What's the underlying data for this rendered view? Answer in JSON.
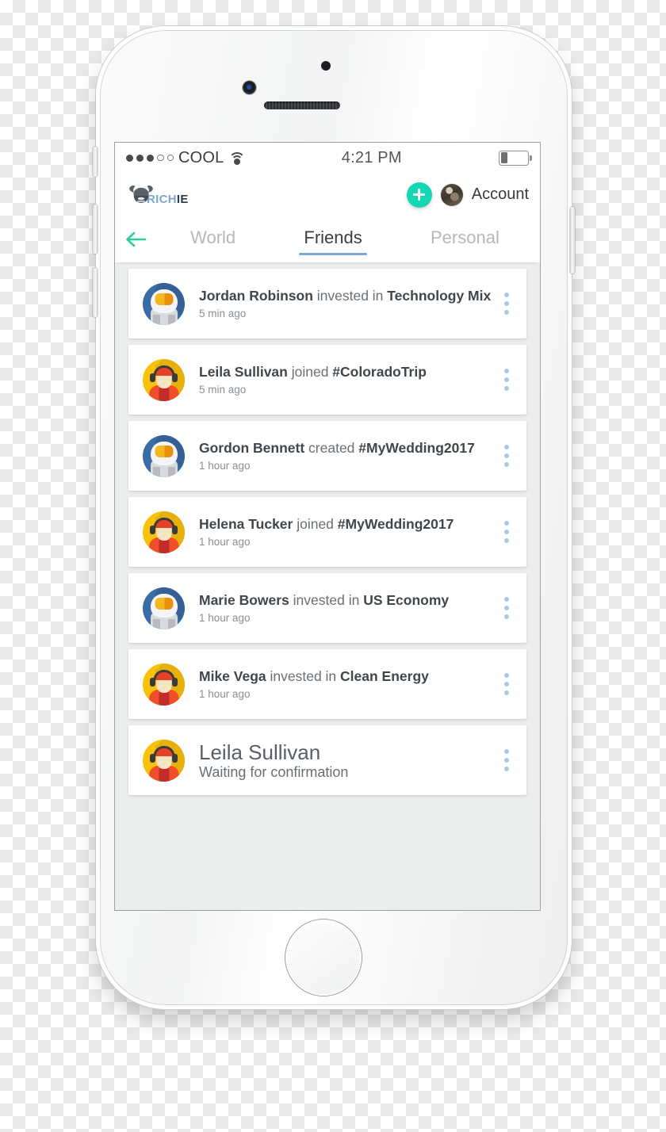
{
  "status_bar": {
    "carrier": "COOL",
    "signal_filled": 3,
    "signal_empty": 2,
    "wifi_icon": "wifi-icon",
    "time": "4:21 PM",
    "battery_percent": 24
  },
  "app_bar": {
    "logo_text_light": "RICH",
    "logo_text_dark": "IE",
    "logo_icon": "viking-horned-head-icon",
    "add_button_icon": "plus-icon",
    "avatar_icon": "account-avatar",
    "account_label": "Account",
    "accent_color": "#14d8b4"
  },
  "nav": {
    "back_icon": "arrow-left-icon",
    "back_color": "#2ecc9b",
    "tabs": [
      {
        "label": "World",
        "active": false
      },
      {
        "label": "Friends",
        "active": true
      },
      {
        "label": "Personal",
        "active": false
      }
    ],
    "active_underline_color": "#7fa8d8"
  },
  "feed": {
    "menu_icon": "kebab-menu-icon",
    "items": [
      {
        "avatar": "astronaut-avatar",
        "actor": "Jordan Robinson",
        "verb": " invested in ",
        "target": "Technology Mix",
        "time": "5 min ago",
        "style": "normal"
      },
      {
        "avatar": "headphones-person-avatar",
        "actor": "Leila Sullivan",
        "verb": " joined ",
        "target": "#ColoradoTrip",
        "time": "5 min ago",
        "style": "normal"
      },
      {
        "avatar": "astronaut-avatar",
        "actor": "Gordon Bennett",
        "verb": " created ",
        "target": "#MyWedding2017",
        "time": "1 hour ago",
        "style": "normal"
      },
      {
        "avatar": "headphones-person-avatar",
        "actor": "Helena Tucker",
        "verb": " joined ",
        "target": "#MyWedding2017",
        "time": "1 hour ago",
        "style": "normal"
      },
      {
        "avatar": "astronaut-avatar",
        "actor": "Marie Bowers",
        "verb": " invested in ",
        "target": "US Economy",
        "time": "1 hour ago",
        "style": "normal"
      },
      {
        "avatar": "headphones-person-avatar",
        "actor": "Mike Vega",
        "verb": " invested in ",
        "target": "Clean Energy",
        "time": "1 hour ago",
        "style": "normal"
      },
      {
        "avatar": "headphones-person-avatar",
        "actor": "Leila Sullivan",
        "verb": "",
        "target": "",
        "time": "Waiting for confirmation",
        "style": "pending"
      }
    ]
  }
}
